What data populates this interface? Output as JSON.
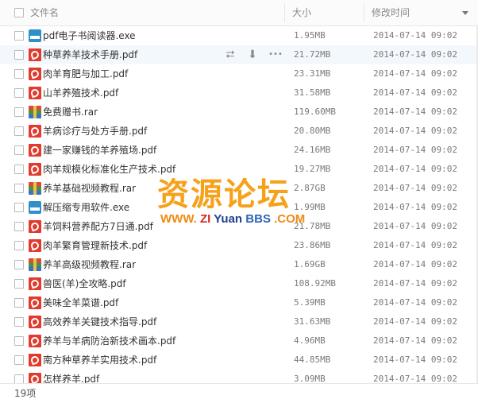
{
  "header": {
    "name_label": "文件名",
    "size_label": "大小",
    "date_label": "修改时间"
  },
  "row_actions": {
    "share_icon": "share-icon",
    "download_icon": "download-icon",
    "more_icon": "more-icon"
  },
  "files": [
    {
      "name": "pdf电子书阅读器.exe",
      "type": "exe",
      "size": "1.95MB",
      "date": "2014-07-14 09:02"
    },
    {
      "name": "种草养羊技术手册.pdf",
      "type": "pdf",
      "size": "21.72MB",
      "date": "2014-07-14 09:02"
    },
    {
      "name": "肉羊育肥与加工.pdf",
      "type": "pdf",
      "size": "23.31MB",
      "date": "2014-07-14 09:02"
    },
    {
      "name": "山羊养殖技术.pdf",
      "type": "pdf",
      "size": "31.58MB",
      "date": "2014-07-14 09:02"
    },
    {
      "name": "免费赠书.rar",
      "type": "rar",
      "size": "119.60MB",
      "date": "2014-07-14 09:02"
    },
    {
      "name": "羊病诊疗与处方手册.pdf",
      "type": "pdf",
      "size": "20.80MB",
      "date": "2014-07-14 09:02"
    },
    {
      "name": "建一家赚钱的羊养殖场.pdf",
      "type": "pdf",
      "size": "24.16MB",
      "date": "2014-07-14 09:02"
    },
    {
      "name": "肉羊规模化标准化生产技术.pdf",
      "type": "pdf",
      "size": "19.27MB",
      "date": "2014-07-14 09:02"
    },
    {
      "name": "养羊基础视频教程.rar",
      "type": "rar",
      "size": "2.87GB",
      "date": "2014-07-14 09:02"
    },
    {
      "name": "解压缩专用软件.exe",
      "type": "exe",
      "size": "1.99MB",
      "date": "2014-07-14 09:02"
    },
    {
      "name": "羊饲料营养配方7日通.pdf",
      "type": "pdf",
      "size": "21.78MB",
      "date": "2014-07-14 09:02"
    },
    {
      "name": "肉羊繁育管理新技术.pdf",
      "type": "pdf",
      "size": "23.86MB",
      "date": "2014-07-14 09:02"
    },
    {
      "name": "养羊高级视频教程.rar",
      "type": "rar",
      "size": "1.69GB",
      "date": "2014-07-14 09:02"
    },
    {
      "name": "兽医(羊)全攻略.pdf",
      "type": "pdf",
      "size": "108.92MB",
      "date": "2014-07-14 09:02"
    },
    {
      "name": "美味全羊菜谱.pdf",
      "type": "pdf",
      "size": "5.39MB",
      "date": "2014-07-14 09:02"
    },
    {
      "name": "高效养羊关键技术指导.pdf",
      "type": "pdf",
      "size": "31.63MB",
      "date": "2014-07-14 09:02"
    },
    {
      "name": "养羊与羊病防治新技术画本.pdf",
      "type": "pdf",
      "size": "4.96MB",
      "date": "2014-07-14 09:02"
    },
    {
      "name": "南方种草养羊实用技术.pdf",
      "type": "pdf",
      "size": "44.85MB",
      "date": "2014-07-14 09:02"
    },
    {
      "name": "怎样养羊.pdf",
      "type": "pdf",
      "size": "3.09MB",
      "date": "2014-07-14 09:02"
    }
  ],
  "footer": {
    "count_label": "19项"
  },
  "watermark": {
    "title": "资源论坛",
    "www": "WWW.",
    "zi": "ZI",
    "yuan": "Yuan",
    "bbs": "BBS",
    "com": ".COM"
  },
  "colors": {
    "pdf_icon": "#e23b2e",
    "exe_icon": "#2f8fc9",
    "hover_row": "#f3f8fd",
    "watermark_orange": "#f7a11a"
  }
}
